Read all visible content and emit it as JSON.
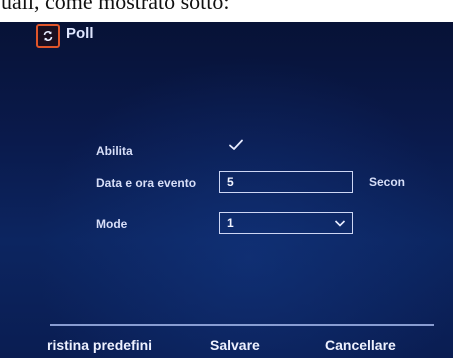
{
  "document": {
    "caption": "uali, come mostrato sotto:"
  },
  "app": {
    "title": "Poll",
    "icon": "refresh-icon",
    "accent": "#e0552a"
  },
  "form": {
    "enable_label": "Abilita",
    "enable_checked": true,
    "event_label": "Data e ora evento",
    "event_value": "5",
    "event_unit": "Secon",
    "mode_label": "Mode",
    "mode_value": "1"
  },
  "footer": {
    "defaults_label": "ristina predefini",
    "save_label": "Salvare",
    "cancel_label": "Cancellare"
  }
}
